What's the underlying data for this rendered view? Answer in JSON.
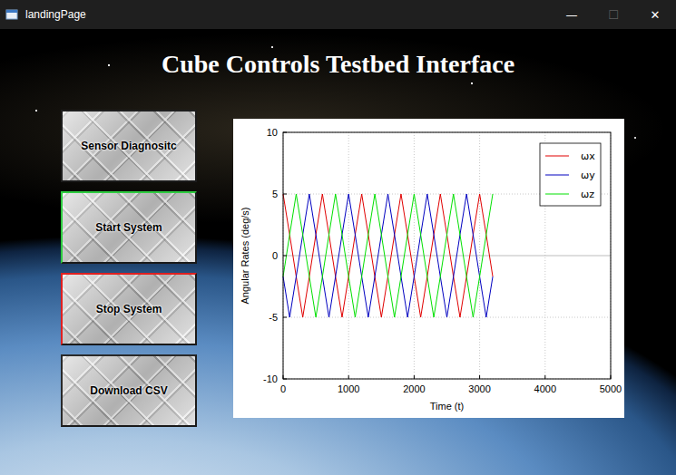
{
  "window": {
    "title": "landingPage",
    "controls": [
      {
        "name": "minimize",
        "glyph": "—",
        "disabled": false
      },
      {
        "name": "maximize",
        "glyph": "☐",
        "disabled": true
      },
      {
        "name": "close",
        "glyph": "✕",
        "disabled": false
      }
    ]
  },
  "heading": "Cube Controls Testbed Interface",
  "buttons": [
    {
      "label": "Sensor Diagnositc",
      "color": "#1e1e1e"
    },
    {
      "label": "Start System",
      "color": "#2ecc40"
    },
    {
      "label": "Stop System",
      "color": "#e02020"
    },
    {
      "label": "Download CSV",
      "color": "#2a2a2a"
    }
  ],
  "chart": {
    "y_axis": {
      "label": "Angular Rates (deg/s)",
      "min": -10,
      "max": 10,
      "ticks": [
        "10",
        "5",
        "0",
        "-5",
        "-10"
      ]
    },
    "x_axis": {
      "label": "Time (t)",
      "min": 0,
      "max": 5000,
      "ticks": [
        "0",
        "1000",
        "2000",
        "3000",
        "4000",
        "5000"
      ]
    },
    "time": [
      0,
      100,
      200,
      300,
      400,
      500,
      600,
      700,
      800,
      900,
      1000,
      1100,
      1200,
      1300,
      1400,
      1500,
      1600,
      1700,
      1800,
      1900,
      2000,
      2100,
      2200,
      2300,
      2400,
      2500,
      2600,
      2700,
      2800,
      2900,
      3000,
      3100,
      3200
    ],
    "series": [
      {
        "name": "ωx",
        "color": "#e00000",
        "values": [
          5,
          1.7,
          -1.7,
          -5,
          -1.7,
          1.7,
          5,
          1.7,
          -1.7,
          -5,
          -1.7,
          1.7,
          5,
          1.7,
          -1.7,
          -5,
          -1.7,
          1.7,
          5,
          1.7,
          -1.7,
          -5,
          -1.7,
          1.7,
          5,
          1.7,
          -1.7,
          -5,
          -1.7,
          1.7,
          5,
          1.7,
          -1.7
        ]
      },
      {
        "name": "ωy",
        "color": "#0000c0",
        "values": [
          -1.7,
          -5,
          -1.7,
          1.7,
          5,
          1.7,
          -1.7,
          -5,
          -1.7,
          1.7,
          5,
          1.7,
          -1.7,
          -5,
          -1.7,
          1.7,
          5,
          1.7,
          -1.7,
          -5,
          -1.7,
          1.7,
          5,
          1.7,
          -1.7,
          -5,
          -1.7,
          1.7,
          5,
          1.7,
          -1.7,
          -5,
          -1.7
        ]
      },
      {
        "name": "ωz",
        "color": "#00e000",
        "values": [
          -1.7,
          1.7,
          5,
          1.7,
          -1.7,
          -5,
          -1.7,
          1.7,
          5,
          1.7,
          -1.7,
          -5,
          -1.7,
          1.7,
          5,
          1.7,
          -1.7,
          -5,
          -1.7,
          1.7,
          5,
          1.7,
          -1.7,
          -5,
          -1.7,
          1.7,
          5,
          1.7,
          -1.7,
          -5,
          -1.7,
          1.7,
          5
        ]
      }
    ]
  }
}
